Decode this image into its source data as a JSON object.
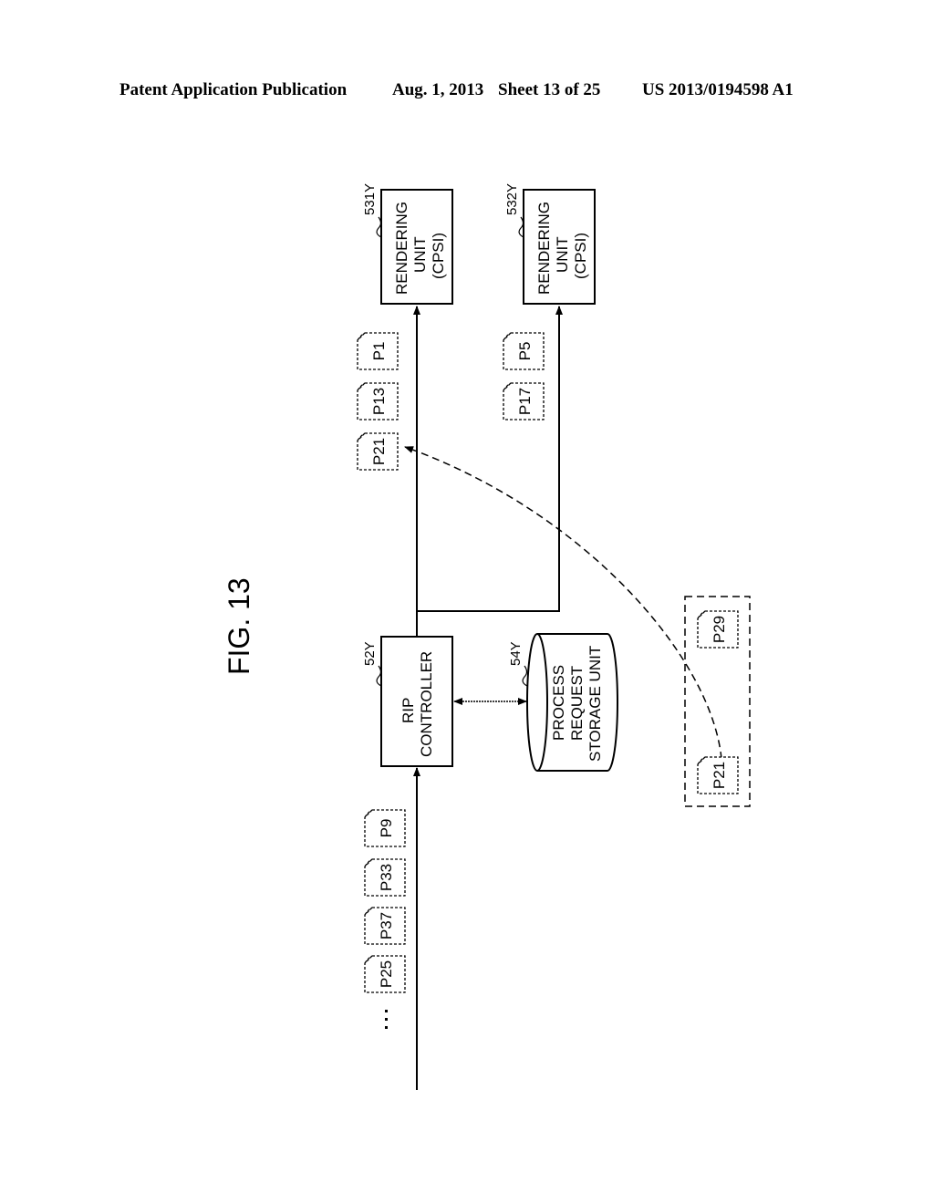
{
  "header": {
    "publication": "Patent Application Publication",
    "date": "Aug. 1, 2013",
    "sheet": "Sheet 13 of 25",
    "patent_number": "US 2013/0194598 A1"
  },
  "figure": {
    "title": "FIG. 13",
    "rendering_units": [
      {
        "ref": "531Y",
        "lines": [
          "RENDERING",
          "UNIT",
          "(CPSI)"
        ]
      },
      {
        "ref": "532Y",
        "lines": [
          "RENDERING",
          "UNIT",
          "(CPSI)"
        ]
      }
    ],
    "rip_controller": {
      "ref": "52Y",
      "lines": [
        "RIP",
        "CONTROLLER"
      ]
    },
    "storage_unit": {
      "ref": "54Y",
      "lines": [
        "PROCESS",
        "REQUEST",
        "STORAGE UNIT"
      ]
    },
    "input_queue": {
      "ellipsis": "...",
      "pages": [
        "P25",
        "P37",
        "P33",
        "P9"
      ]
    },
    "unit1_queue": [
      "P21",
      "P13",
      "P1"
    ],
    "unit2_queue": [
      "P17",
      "P5"
    ],
    "stored_requests": [
      "P21",
      "P29"
    ]
  }
}
